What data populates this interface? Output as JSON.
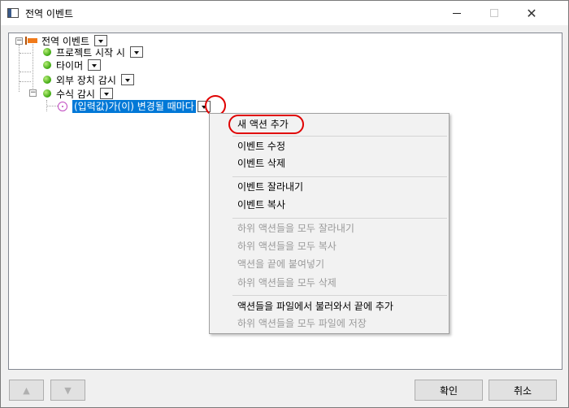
{
  "window": {
    "title": "전역 이벤트",
    "minimize_icon": "minimize-icon",
    "maximize_icon": "maximize-icon",
    "close_glyph": "✕"
  },
  "tree": {
    "root": {
      "label": "전역 이벤트",
      "icon": "flag-icon"
    },
    "items": [
      {
        "label": "프로젝트 시작 시",
        "icon": "green-dot-icon"
      },
      {
        "label": "타이머",
        "icon": "green-dot-icon"
      },
      {
        "label": "외부 장치 감시",
        "icon": "green-dot-icon"
      },
      {
        "label": "수식 감시",
        "icon": "green-dot-icon"
      }
    ],
    "child": {
      "label": "(입력값)가(이) 변경될 때마다",
      "icon": "target-icon"
    }
  },
  "context_menu": {
    "groups": [
      [
        {
          "label": "새 액션 추가",
          "enabled": true
        }
      ],
      [
        {
          "label": "이벤트 수정",
          "enabled": true
        },
        {
          "label": "이벤트 삭제",
          "enabled": true
        }
      ],
      [
        {
          "label": "이벤트 잘라내기",
          "enabled": true
        },
        {
          "label": "이벤트 복사",
          "enabled": true
        }
      ],
      [
        {
          "label": "하위 액션들을 모두 잘라내기",
          "enabled": false
        },
        {
          "label": "하위 액션들을 모두 복사",
          "enabled": false
        },
        {
          "label": "액션을 끝에 붙여넣기",
          "enabled": false
        },
        {
          "label": "하위 액션들을 모두 삭제",
          "enabled": false
        }
      ],
      [
        {
          "label": "액션들을 파일에서 불러와서 끝에 추가",
          "enabled": true
        },
        {
          "label": "하위 액션들을 모두 파일에 저장",
          "enabled": false
        }
      ]
    ]
  },
  "footer": {
    "up_glyph": "▲",
    "down_glyph": "▼",
    "ok_label": "확인",
    "cancel_label": "취소"
  },
  "colors": {
    "selection": "#0078d7",
    "highlight_circle": "#e00000",
    "disabled_text": "#9a9a9a"
  }
}
